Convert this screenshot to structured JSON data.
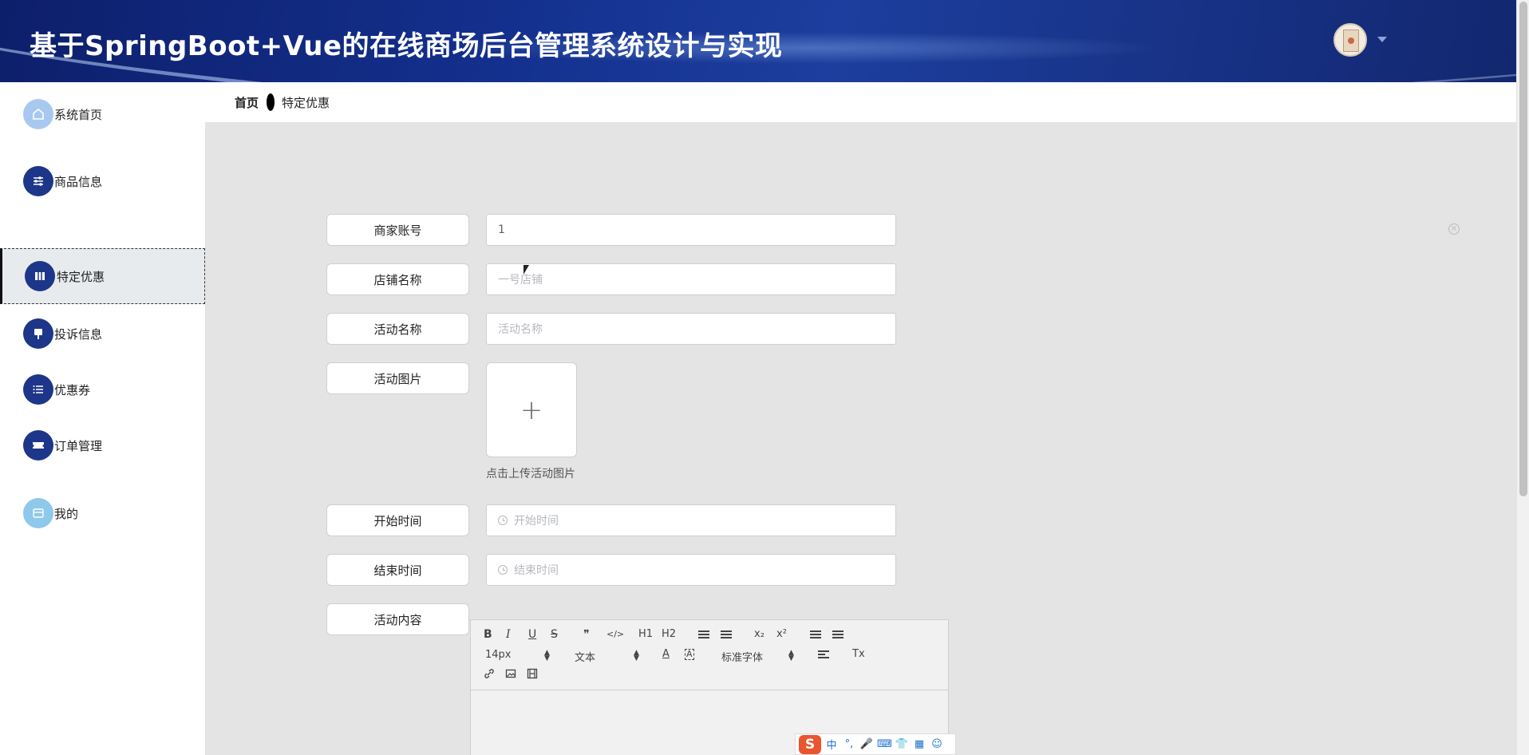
{
  "header": {
    "title": "基于SpringBoot+Vue的在线商场后台管理系统设计与实现",
    "colors": {
      "bg": "#14318f",
      "text": "#ffffff"
    }
  },
  "user": {
    "avatar_icon": "certificate-avatar-icon",
    "dropdown_icon": "caret-down-icon"
  },
  "breadcrumb": {
    "home": "首页",
    "current": "特定优惠"
  },
  "sidebar": {
    "items": [
      {
        "label": "系统首页",
        "icon": "home-icon"
      },
      {
        "label": "商品信息",
        "icon": "sliders-icon"
      },
      {
        "label": "特定优惠",
        "icon": "tag-icon",
        "active": true
      },
      {
        "label": "投诉信息",
        "icon": "pin-icon"
      },
      {
        "label": "优惠券",
        "icon": "list-icon"
      },
      {
        "label": "订单管理",
        "icon": "ticket-icon"
      },
      {
        "label": "我的",
        "icon": "card-icon"
      }
    ],
    "colors": {
      "accent": "#1d3689",
      "light": "#a9c8ef"
    }
  },
  "form": {
    "merchant_account": {
      "label": "商家账号",
      "value": "1"
    },
    "shop_name": {
      "label": "店铺名称",
      "placeholder": "一号店铺"
    },
    "activity_name": {
      "label": "活动名称",
      "placeholder": "活动名称"
    },
    "activity_image": {
      "label": "活动图片",
      "upload_glyph": "+",
      "tip": "点击上传活动图片"
    },
    "start_time": {
      "label": "开始时间",
      "placeholder": "开始时间"
    },
    "end_time": {
      "label": "结束时间",
      "placeholder": "结束时间"
    },
    "content": {
      "label": "活动内容"
    }
  },
  "editor": {
    "toolbar": {
      "bold": "B",
      "italic": "I",
      "underline": "U",
      "strike": "S",
      "quote": "❞",
      "code": "</>",
      "h1": "H1",
      "h2": "H2",
      "subscript": "x₂",
      "superscript": "x²",
      "font_size": "14px",
      "header_select": "文本",
      "font_family": "标准字体",
      "text_color": "A",
      "clean": "Tx"
    }
  },
  "ime": {
    "logo": "S",
    "mode": "中",
    "punct": "°,",
    "mic": "🎤",
    "keyboard": "⌨",
    "skin": "👕",
    "apps": "▦",
    "emoji": "☺"
  }
}
